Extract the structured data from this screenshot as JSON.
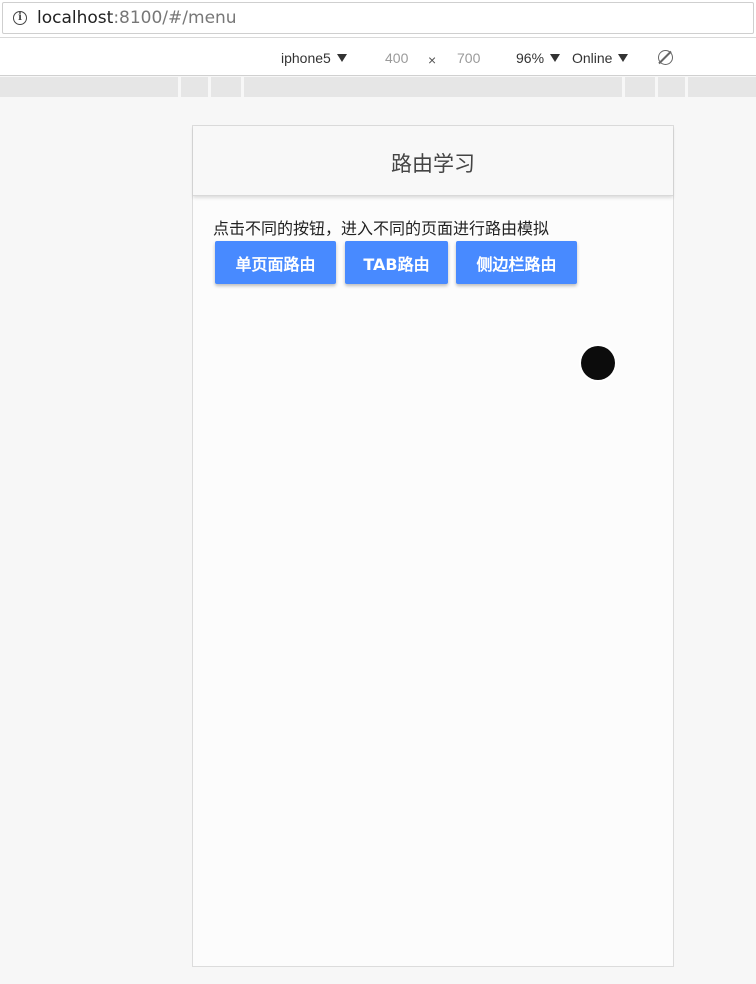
{
  "browser": {
    "url_host": "localhost",
    "url_rest": ":8100/#/menu"
  },
  "device_toolbar": {
    "device": "iphone5",
    "width": "400",
    "times": "×",
    "height": "700",
    "zoom": "96%",
    "network": "Online"
  },
  "page": {
    "title": "路由学习",
    "description": "点击不同的按钮，进入不同的页面进行路由模拟",
    "buttons": [
      {
        "label": "单页面路由"
      },
      {
        "label": "TAB路由"
      },
      {
        "label": "侧边栏路由"
      }
    ]
  },
  "colors": {
    "button": "#488aff"
  }
}
